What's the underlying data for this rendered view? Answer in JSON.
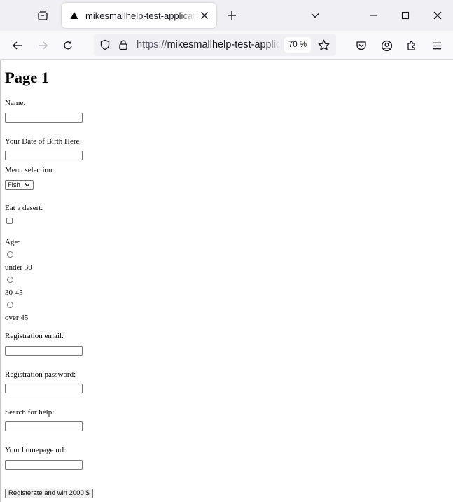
{
  "browser": {
    "tab": {
      "title": "mikesmallhelp-test-application"
    },
    "url": {
      "scheme": "https://",
      "host": "mikesmallhelp-test-applic"
    },
    "zoom": "70 %"
  },
  "page": {
    "title": "Page 1",
    "name_label": "Name:",
    "dob_label": "Your Date of Birth Here",
    "menu_label": "Menu selection:",
    "menu_selected": "Fish",
    "desert_label": "Eat a desert:",
    "age_label": "Age:",
    "age_options": [
      "under 30",
      "30-45",
      "over 45"
    ],
    "email_label": "Registration email:",
    "password_label": "Registration password:",
    "search_label": "Search for help:",
    "homepage_label": "Your homepage url:",
    "submit_label": "Registerate and win 2000 $"
  }
}
